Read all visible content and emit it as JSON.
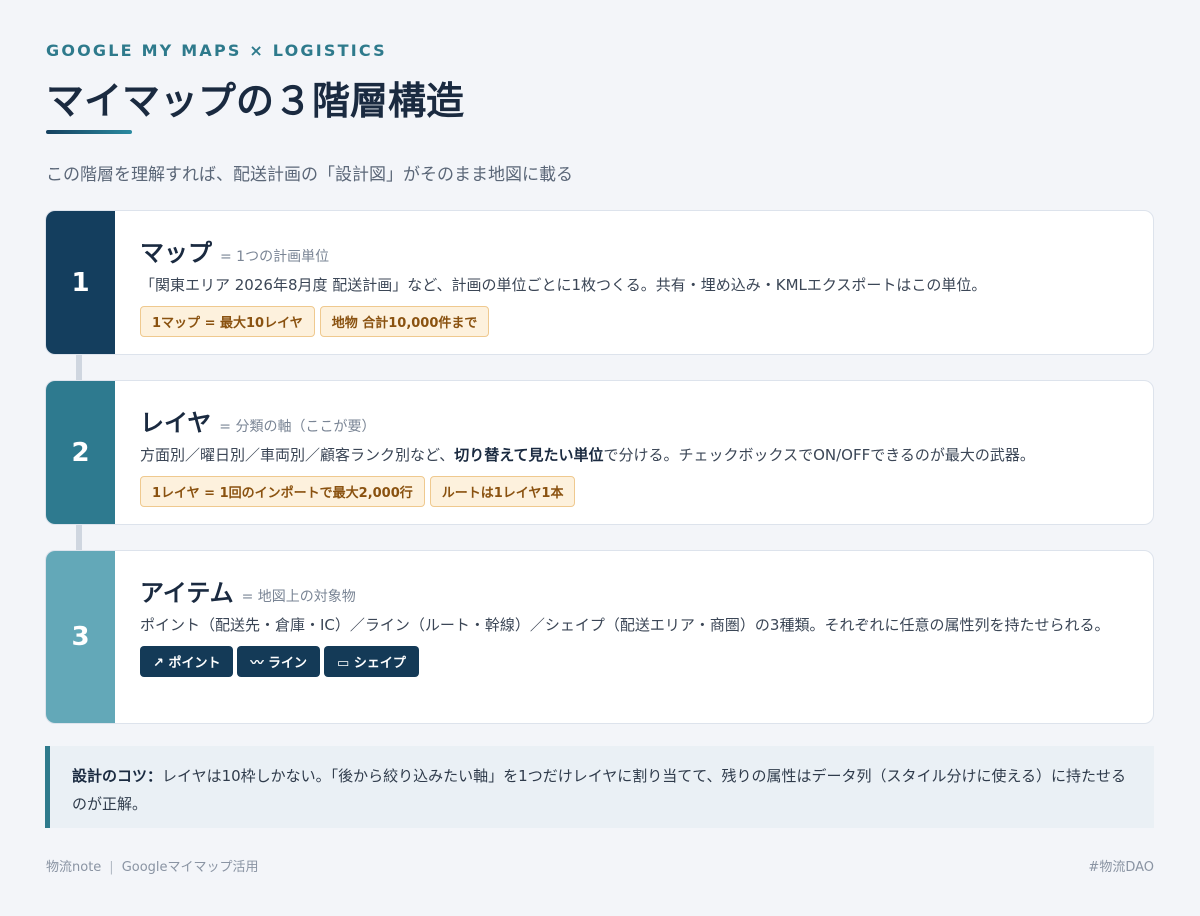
{
  "header": {
    "eyebrow": "GOOGLE MY MAPS × LOGISTICS",
    "title": "マイマップの３階層構造",
    "subtitle": "この階層を理解すれば、配送計画の「設計図」がそのまま地図に載る"
  },
  "levels": [
    {
      "number": "1",
      "name": "マップ",
      "desc": "= 1つの計画単位",
      "text": "「関東エリア 2026年8月度 配送計画」など、計画の単位ごとに1枚つくる。共有・埋め込み・KMLエクスポートはこの単位。",
      "tags": [
        "1マップ = 最大10レイヤ",
        "地物 合計10,000件まで"
      ],
      "color": "#143e5e"
    },
    {
      "number": "2",
      "name": "レイヤ",
      "desc": "= 分類の軸（ここが要）",
      "text_before": "方面別／曜日別／車両別／顧客ランク別など、",
      "text_bold": "切り替えて見たい単位",
      "text_after": "で分ける。チェックボックスでON/OFFできるのが最大の武器。",
      "tags": [
        "1レイヤ = 1回のインポートで最大2,000行",
        "ルートは1レイヤ1本"
      ],
      "color": "#2e7a8f"
    },
    {
      "number": "3",
      "name": "アイテム",
      "desc": "= 地図上の対象物",
      "text": "ポイント（配送先・倉庫・IC）／ライン（ルート・幹線）／シェイプ（配送エリア・商圏）の3種類。それぞれに任意の属性列を持たせられる。",
      "chips": [
        {
          "icon": "↗",
          "label": "ポイント"
        },
        {
          "icon": "〰",
          "label": "ライン"
        },
        {
          "icon": "▭",
          "label": "シェイプ"
        }
      ],
      "color": "#63a8b8"
    }
  ],
  "tip": {
    "label": "設計のコツ：",
    "text": "レイヤは10枠しかない。「後から絞り込みたい軸」を1つだけレイヤに割り当てて、残りの属性はデータ列（スタイル分けに使える）に持たせるのが正解。"
  },
  "footer": {
    "left_a": "物流note",
    "separator": "|",
    "left_b": "Googleマイマップ活用",
    "right": "#物流DAO"
  }
}
